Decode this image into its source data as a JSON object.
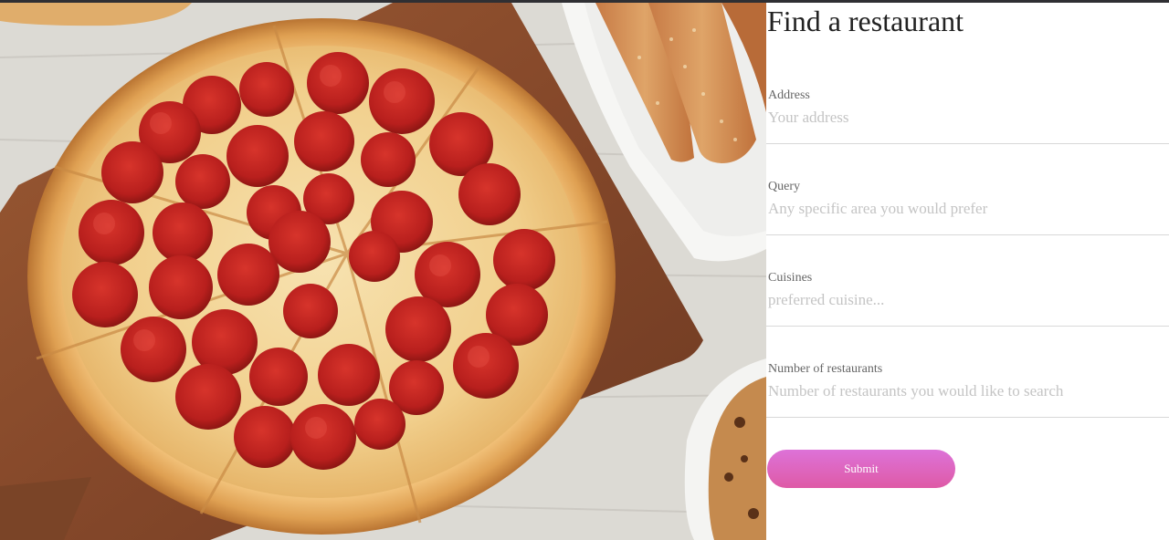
{
  "form": {
    "title": "Find a restaurant",
    "fields": [
      {
        "label": "Address",
        "placeholder": "Your address",
        "value": ""
      },
      {
        "label": "Query",
        "placeholder": "Any specific area you would prefer",
        "value": ""
      },
      {
        "label": "Cuisines",
        "placeholder": "preferred cuisine...",
        "value": ""
      },
      {
        "label": "Number of restaurants",
        "placeholder": "Number of restaurants you would like to search",
        "value": ""
      }
    ],
    "submit_label": "Submit"
  },
  "colors": {
    "button_gradient_top": "#dd72d8",
    "button_gradient_bottom": "#de5aa6",
    "title_text": "#222222",
    "label_text": "#666666",
    "placeholder_text": "#c4c4c4",
    "divider": "#d8d8d8"
  },
  "hero": {
    "subject": "pepperoni pizza on wooden board"
  }
}
